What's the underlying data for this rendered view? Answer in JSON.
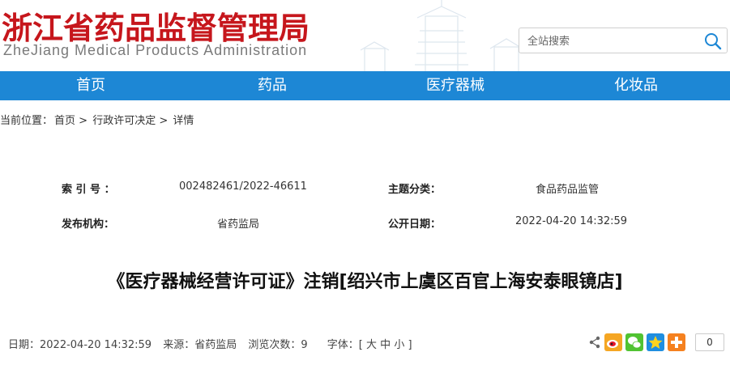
{
  "header": {
    "logo_cn": "浙江省药品监督管理局",
    "logo_en": "ZheJiang Medical Products Administration",
    "search_placeholder": "全站搜索"
  },
  "nav": {
    "items": [
      "首页",
      "药品",
      "医疗器械",
      "化妆品"
    ]
  },
  "breadcrumb": {
    "prefix": "当前位置：",
    "items": [
      "首页",
      "行政许可决定",
      "详情"
    ],
    "separator": ">"
  },
  "info": {
    "index_label": "索 引 号 ：",
    "index_value": "002482461/2022-46611",
    "topic_label": "主题分类：",
    "topic_value": "食品药品监管",
    "org_label": "发布机构：",
    "org_value": "省药监局",
    "date_label": "公开日期：",
    "date_value": "2022-04-20 14:32:59"
  },
  "article": {
    "title": "《医疗器械经营许可证》注销[绍兴市上虞区百官上海安泰眼镜店]"
  },
  "meta": {
    "date": "日期：2022-04-20 14:32:59",
    "source": "来源：省药监局",
    "views": "浏览次数：9",
    "font_label": "字体：[",
    "font_large": "大",
    "font_medium": "中",
    "font_small": "小",
    "font_close": "]"
  },
  "share": {
    "count": "0"
  }
}
